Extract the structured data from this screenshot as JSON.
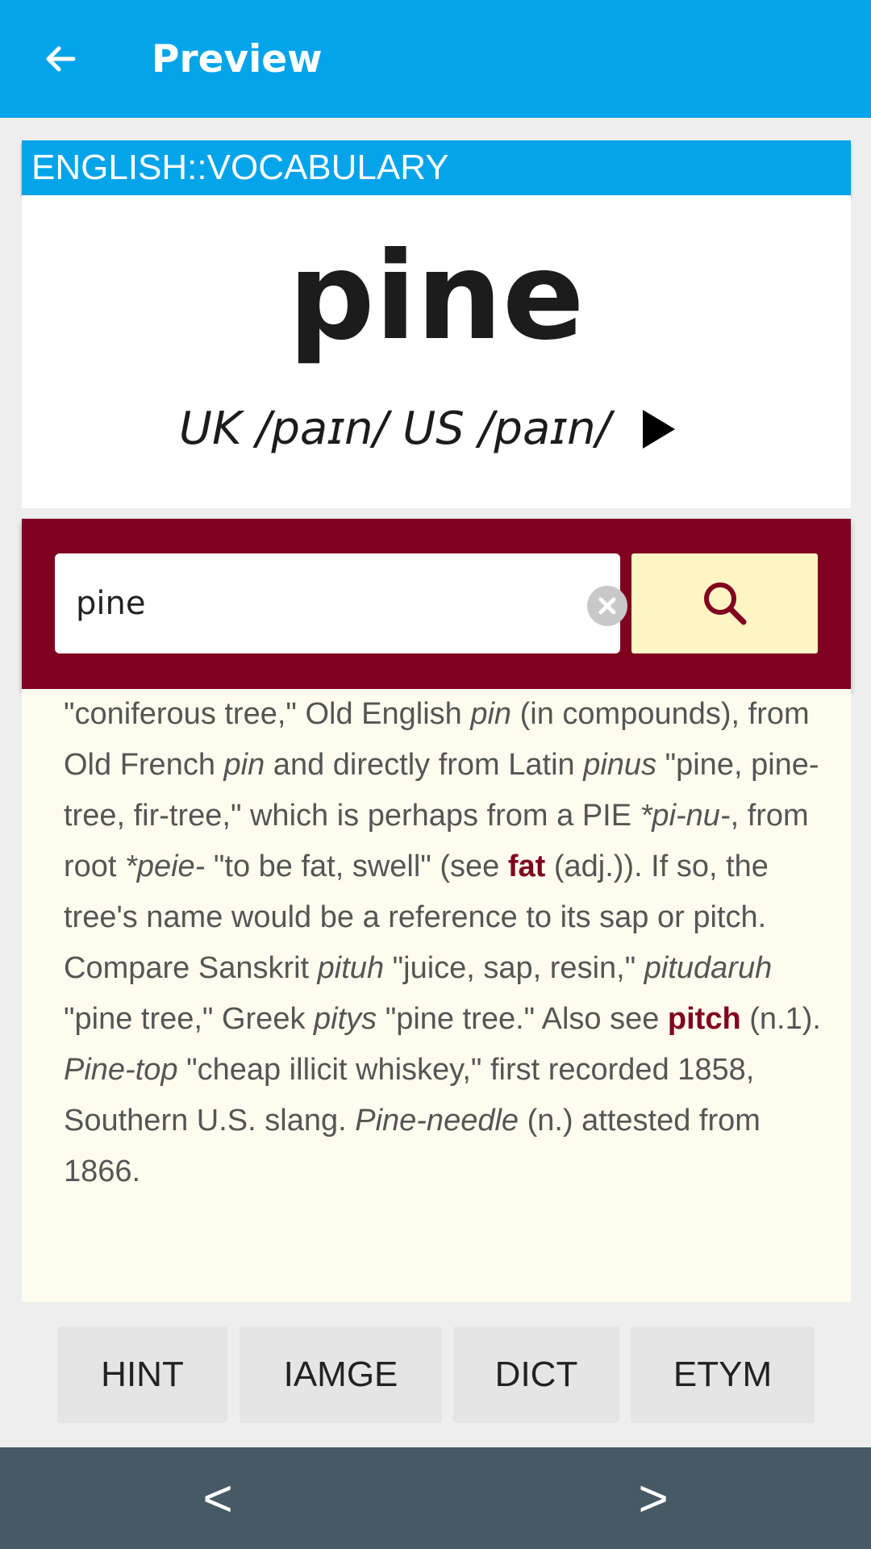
{
  "appbar": {
    "title": "Preview",
    "back_icon": "arrow-left-icon"
  },
  "deck": {
    "name": "ENGLISH::VOCABULARY"
  },
  "card": {
    "word": "pine",
    "pronunciation": "UK /paɪn/ US /paɪn/",
    "play_icon": "play-icon"
  },
  "search": {
    "value": "pine",
    "clear_icon": "clear-icon",
    "search_icon": "search-icon",
    "accent_color": "#800020",
    "button_color": "#fff4c4"
  },
  "etymology": {
    "t1": "\"coniferous tree,\" Old English ",
    "i1": "pin",
    "t2": " (in compounds), from Old French ",
    "i2": "pin",
    "t3": " and directly from Latin ",
    "i3": "pinus",
    "t4": " \"pine, pine-tree, fir-tree,\" which is perhaps from a PIE ",
    "i4": "*pi-nu-",
    "t5": ", from root ",
    "i5": "*peie-",
    "t6": " \"to be fat, swell\" (see ",
    "link1": "fat",
    "t7": " (adj.)). If so, the tree's name would be a reference to its sap or pitch. Compare Sanskrit ",
    "i6": "pituh",
    "t8": " \"juice, sap, resin,\" ",
    "i7": "pitudaruh",
    "t9": " \"pine tree,\" Greek ",
    "i8": "pitys",
    "t10": " \"pine tree.\" Also see ",
    "link2": "pitch",
    "t11": " (n.1). ",
    "i9": "Pine-top",
    "t12": " \"cheap illicit whiskey,\" first recorded 1858, Southern U.S. slang. ",
    "i10": "Pine-needle",
    "t13": " (n.) attested from 1866."
  },
  "tabs": [
    "HINT",
    "IAMGE",
    "DICT",
    "ETYM"
  ],
  "nav": {
    "prev": "<",
    "next": ">"
  },
  "colors": {
    "primary": "#04a4ea",
    "accent": "#800020",
    "nav_bar": "#455a64",
    "panel": "#fffcef"
  }
}
